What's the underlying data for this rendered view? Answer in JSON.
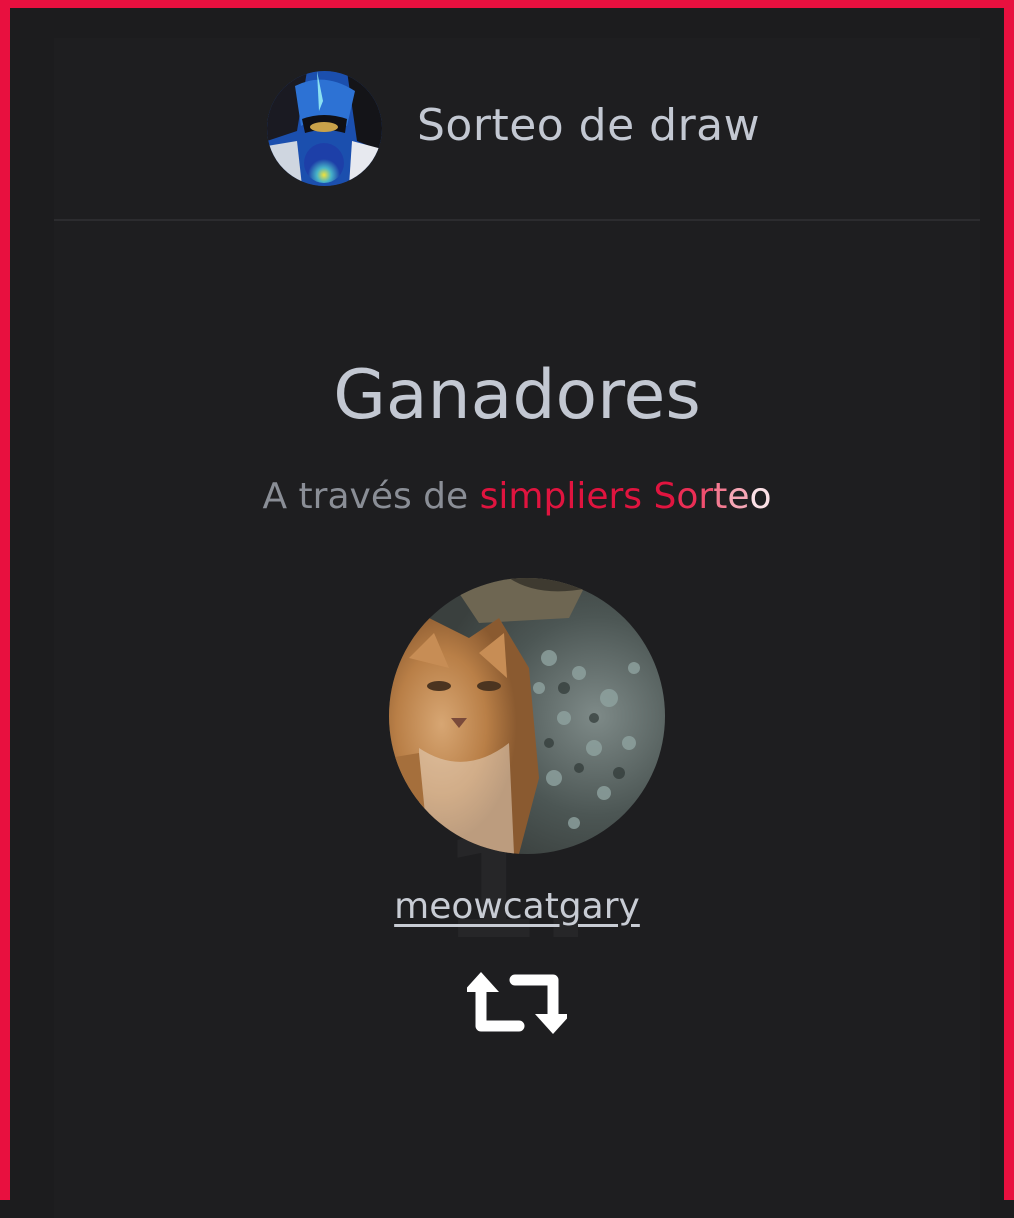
{
  "header": {
    "title": "Sorteo de draw",
    "avatar_icon": "profile-avatar"
  },
  "main": {
    "title": "Ganadores",
    "subtitle_prefix": "A través de ",
    "subtitle_brand": "simpliers",
    "subtitle_suffix_letters": [
      "S",
      "o",
      "r",
      "t",
      "e",
      "o"
    ],
    "rank": "1.",
    "winner": {
      "username": "meowcatgary",
      "avatar_icon": "cat-avatar"
    },
    "action_icon": "retweet-icon"
  },
  "colors": {
    "accent": "#e8103f",
    "background": "#1c1c1e",
    "text": "#c3c8d2"
  }
}
